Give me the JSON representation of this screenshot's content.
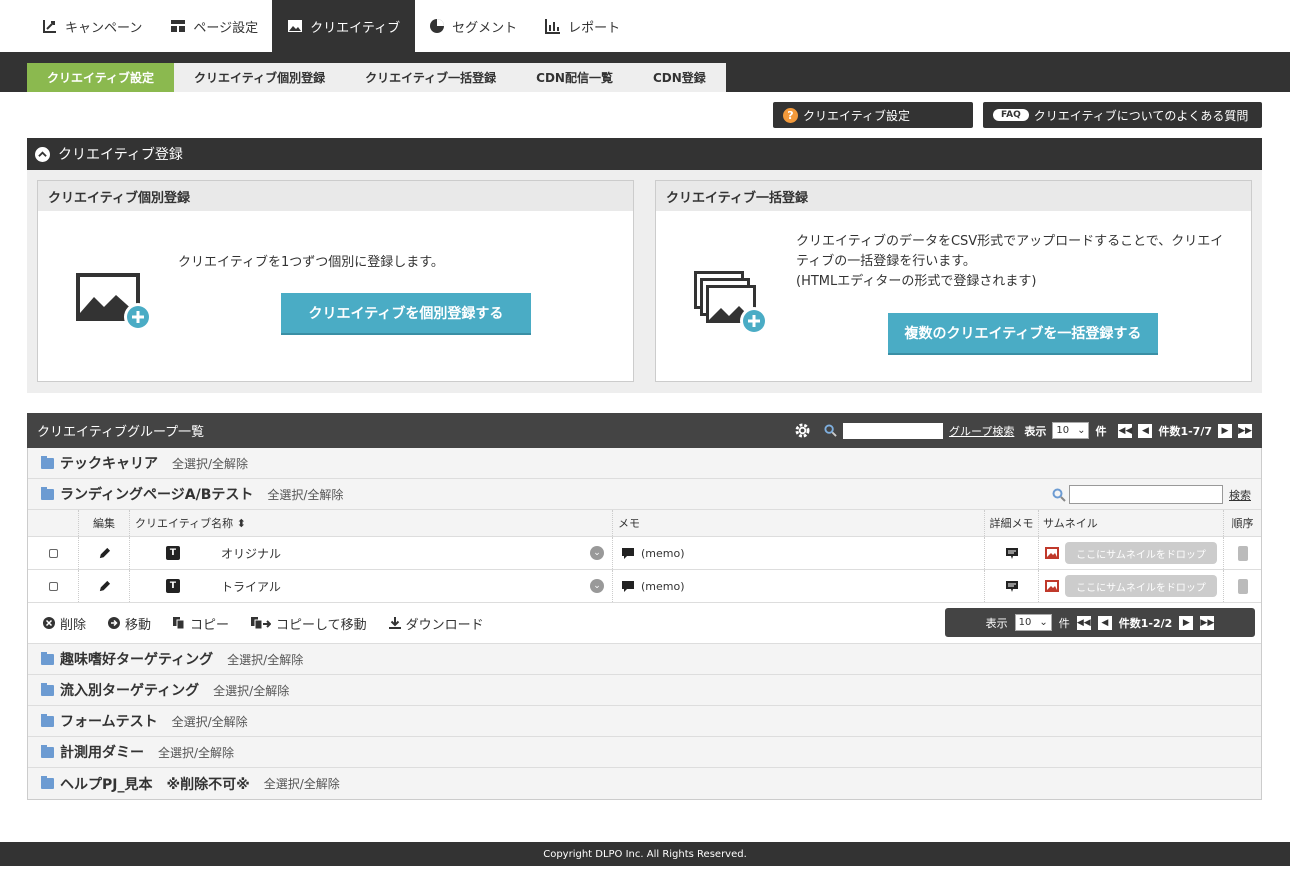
{
  "topnav": {
    "tabs": [
      {
        "label": "キャンペーン",
        "icon": "campaign-icon"
      },
      {
        "label": "ページ設定",
        "icon": "page-settings-icon"
      },
      {
        "label": "クリエイティブ",
        "icon": "image-icon"
      },
      {
        "label": "セグメント",
        "icon": "pie-chart-icon"
      },
      {
        "label": "レポート",
        "icon": "bar-chart-icon"
      }
    ],
    "active_index": 2
  },
  "subnav": {
    "tabs": [
      "クリエイティブ設定",
      "クリエイティブ個別登録",
      "クリエイティブ一括登録",
      "CDN配信一覧",
      "CDN登録"
    ],
    "active_index": 0
  },
  "help": {
    "settings_label": "クリエイティブ設定",
    "faq_badge": "FAQ",
    "faq_label": "クリエイティブについてのよくある質問"
  },
  "register": {
    "title": "クリエイティブ登録",
    "single": {
      "title": "クリエイティブ個別登録",
      "desc": "クリエイティブを1つずつ個別に登録します。",
      "button": "クリエイティブを個別登録する"
    },
    "bulk": {
      "title": "クリエイティブ一括登録",
      "desc1": "クリエイティブのデータをCSV形式でアップロードすることで、クリエイ",
      "desc2": "ティブの一括登録を行います。",
      "desc3": "(HTMLエディターの形式で登録されます)",
      "button": "複数のクリエイティブを一括登録する"
    }
  },
  "grouplist": {
    "title": "クリエイティブグループ一覧",
    "search_link": "グループ検索",
    "display_label": "表示",
    "per_page": "10",
    "unit": "件",
    "count": "件数1-7/7",
    "select_all": "全選択/全解除",
    "groups": [
      {
        "name": "テックキャリア"
      },
      {
        "name": "ランディングページA/Bテスト"
      },
      {
        "name": "趣味嗜好ターゲティング"
      },
      {
        "name": "流入別ターゲティング"
      },
      {
        "name": "フォームテスト"
      },
      {
        "name": "計測用ダミー"
      },
      {
        "name": "ヘルプPJ_見本　※削除不可※"
      }
    ],
    "inner": {
      "search_link": "検索",
      "headers": {
        "edit": "編集",
        "name": "クリエイティブ名称 ⬍",
        "memo": "メモ",
        "detail": "詳細メモ",
        "thumb": "サムネイル",
        "order": "順序"
      },
      "rows": [
        {
          "type_badge": "T",
          "name": "オリジナル",
          "memo": "(memo)",
          "drop": "ここにサムネイルをドロップ"
        },
        {
          "type_badge": "T",
          "name": "トライアル",
          "memo": "(memo)",
          "drop": "ここにサムネイルをドロップ"
        }
      ],
      "actions": {
        "delete": "削除",
        "move": "移動",
        "copy": "コピー",
        "copy_move": "コピーして移動",
        "download": "ダウンロード"
      },
      "pager": {
        "display_label": "表示",
        "per_page": "10",
        "unit": "件",
        "count": "件数1-2/2"
      }
    }
  },
  "footer": "Copyright DLPO Inc. All Rights Reserved."
}
